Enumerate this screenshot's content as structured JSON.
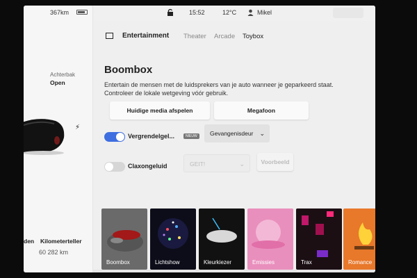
{
  "status": {
    "range": "367km",
    "time": "15:52",
    "temp": "12°C",
    "user": "Mikel"
  },
  "vehicle": {
    "trunk_label": "Achterbak",
    "trunk_value": "Open",
    "odometer_label_a": "den",
    "odometer_label": "Kilometerteller",
    "odometer_value": "60 282 km"
  },
  "nav": {
    "section": "Entertainment",
    "tabs": [
      {
        "label": "Theater",
        "active": false
      },
      {
        "label": "Arcade",
        "active": false
      },
      {
        "label": "Toybox",
        "active": true
      }
    ]
  },
  "boombox": {
    "title": "Boombox",
    "description": "Entertain de mensen met de luidsprekers van je auto wanneer je geparkeerd staat. Controleer de lokale wetgeving vóór gebruik.",
    "btn_media": "Huidige media afspelen",
    "btn_mega": "Megafoon",
    "lock_label": "Vergrendelgel...",
    "lock_badge": "NIEUW",
    "lock_on": true,
    "lock_sound": "Gevangenisdeur",
    "horn_label": "Claxongeluid",
    "horn_on": false,
    "horn_sound": "GEIT!",
    "preview": "Voorbeeld"
  },
  "tiles": [
    {
      "label": "Boombox",
      "color": "#6a6a6a"
    },
    {
      "label": "Lichtshow",
      "color": "#0d0d1a"
    },
    {
      "label": "Kleurkiezer",
      "color": "#111111"
    },
    {
      "label": "Emissies",
      "color": "#e98fbd"
    },
    {
      "label": "Trax",
      "color": "#1b0f14"
    },
    {
      "label": "Romance",
      "color": "#e8782a"
    }
  ],
  "colors": {
    "accent": "#3e6ee0"
  }
}
